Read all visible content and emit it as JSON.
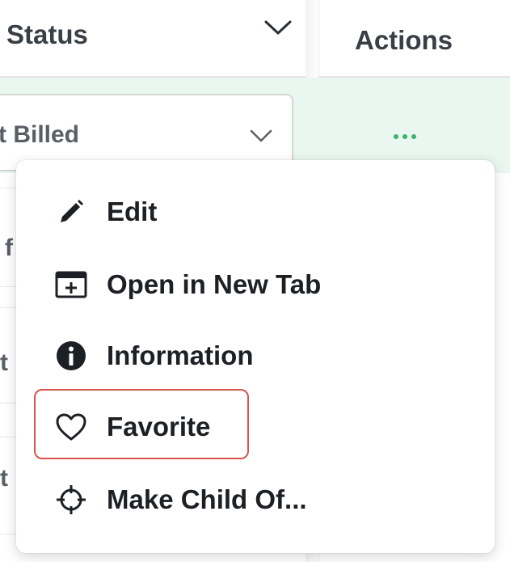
{
  "header": {
    "status_label": "Status",
    "actions_label": "Actions"
  },
  "row": {
    "status_value": "t Billed",
    "actions_menu_icon": "more-horizontal-icon"
  },
  "background_cut_text": [
    "f",
    "t",
    "t"
  ],
  "menu": {
    "items": [
      {
        "label": "Edit",
        "icon": "pencil-icon"
      },
      {
        "label": "Open in New Tab",
        "icon": "open-new-tab-icon"
      },
      {
        "label": "Information",
        "icon": "info-icon"
      },
      {
        "label": "Favorite",
        "icon": "heart-icon"
      },
      {
        "label": "Make Child Of...",
        "icon": "crosshair-icon"
      }
    ],
    "highlighted_item": "Favorite"
  },
  "colors": {
    "row_highlight": "#eaf6f0",
    "accent_green": "#3bb26e",
    "highlight_border": "#d9544a"
  }
}
